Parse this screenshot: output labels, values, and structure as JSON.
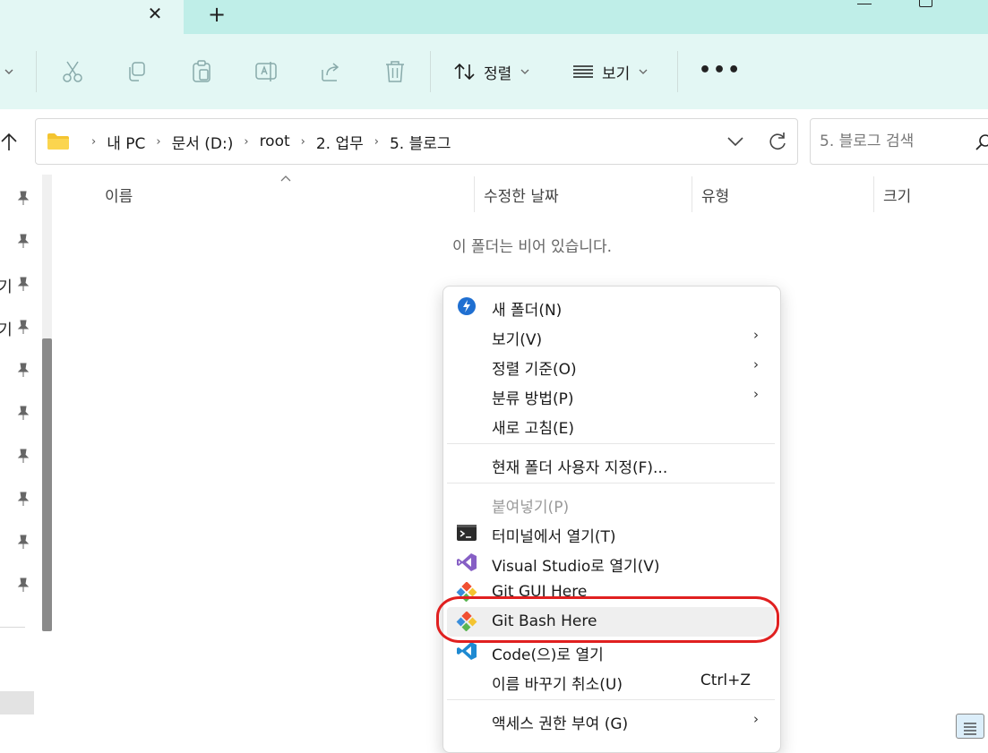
{
  "titlebar": {
    "close_glyph": "✕",
    "new_tab_glyph": "+"
  },
  "toolbar": {
    "sort_label": "정렬",
    "view_label": "보기",
    "more_label": "•••",
    "icons": [
      "cut-icon",
      "copy-icon",
      "paste-icon",
      "rename-icon",
      "share-icon",
      "delete-icon"
    ]
  },
  "address": {
    "crumbs": [
      "내 PC",
      "문서 (D:)",
      "root",
      "2. 업무",
      "5. 블로그"
    ],
    "separator": "›"
  },
  "search": {
    "placeholder": "5. 블로그 검색"
  },
  "nav": {
    "partial_labels": [
      "기",
      "기"
    ]
  },
  "columns": {
    "name": "이름",
    "modified": "수정한 날짜",
    "type": "유형",
    "size": "크기"
  },
  "empty_message": "이 폴더는 비어 있습니다.",
  "context_menu": {
    "items": [
      {
        "label": "새 폴더(N)",
        "icon": "new-folder-icon"
      },
      {
        "label": "보기(V)",
        "submenu": true
      },
      {
        "label": "정렬 기준(O)",
        "submenu": true
      },
      {
        "label": "분류 방법(P)",
        "submenu": true
      },
      {
        "label": "새로 고침(E)"
      },
      {
        "label": "현재 폴더 사용자 지정(F)..."
      },
      {
        "label": "붙여넣기(P)",
        "disabled": true
      },
      {
        "label": "터미널에서 열기(T)",
        "icon": "terminal-icon"
      },
      {
        "label": "Visual Studio로 열기(V)",
        "icon": "visual-studio-icon"
      },
      {
        "label": "Git GUI Here",
        "icon": "git-gui-icon"
      },
      {
        "label": "Git Bash Here",
        "icon": "git-bash-icon",
        "highlighted": true
      },
      {
        "label": "Code(으)로 열기",
        "icon": "vscode-icon"
      },
      {
        "label": "이름 바꾸기 취소(U)",
        "shortcut": "Ctrl+Z"
      },
      {
        "label": "액세스 권한 부여 (G)",
        "submenu": true
      }
    ],
    "submenu_arrow": "›"
  },
  "colors": {
    "tab_strip": "#bfeee8",
    "command_bar": "#e3f7f4",
    "highlight_ring": "#e02020",
    "folder": "#f4c430",
    "vs_purple": "#865fc5",
    "vscode_blue": "#1f8ad2"
  }
}
